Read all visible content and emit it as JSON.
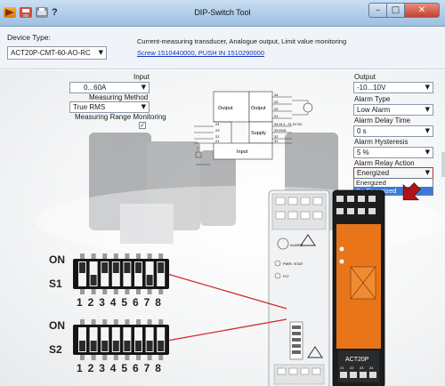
{
  "window": {
    "title": "DIP-Switch Tool",
    "help_glyph": "?",
    "icons": [
      "app-logo-icon",
      "save-icon",
      "print-icon"
    ]
  },
  "header": {
    "device_type_label": "Device Type:",
    "device_type_value": "ACT20P-CMT-60-AO-RC",
    "description": "Current-measuring transducer, Analogue output, Limit value monitoring",
    "link": "Screw 1510440000, PUSH IN 1510290000"
  },
  "input": {
    "title": "Input",
    "range_value": "0...60A",
    "method_label": "Measuring Method",
    "method_value": "True RMS",
    "monitoring_label": "Measuring Range Monitoring",
    "monitoring_checked": "✓"
  },
  "output": {
    "title": "Output",
    "output_value": "-10...10V",
    "alarm_type_label": "Alarm Type",
    "alarm_type_value": "Low Alarm",
    "alarm_delay_label": "Alarm Delay Time",
    "alarm_delay_value": "0 s",
    "alarm_hysteresis_label": "Alarm Hysteresis",
    "alarm_hysteresis_value": "5 %",
    "relay_action_label": "Alarm Relay Action",
    "relay_action_value": "Energized",
    "relay_action_options": [
      "Energized",
      "De Energized"
    ]
  },
  "diagram": {
    "output_label_1": "Output",
    "output_label_2": "Output",
    "supply_label": "Supply",
    "input_label": "Input",
    "pins_top": [
      "44",
      "43",
      "42",
      "41"
    ],
    "pins_mid": [
      "34",
      "33",
      "32",
      "31"
    ],
    "pins_left": [
      "24",
      "23",
      "22",
      "21"
    ],
    "supply_text_1": "19.2...31.2V DC",
    "supply_text_2": "GND"
  },
  "dip": {
    "s1_on_label": "ON",
    "s1_name": "S1",
    "s2_on_label": "ON",
    "s2_name": "S2",
    "numbers": [
      "1",
      "2",
      "3",
      "4",
      "5",
      "6",
      "7",
      "8"
    ],
    "s1_states": [
      "up",
      "down",
      "up",
      "up",
      "up",
      "up",
      "down",
      "up"
    ],
    "s2_states": [
      "down",
      "down",
      "down",
      "down",
      "down",
      "down",
      "down",
      "down"
    ]
  },
  "device": {
    "front_label_1": "ALARM",
    "front_label_2": "PWR / STAT",
    "front_label_3": "FLT",
    "orange_model": "ACT20P",
    "orange_terminals": [
      "21",
      "22",
      "23",
      "24"
    ]
  },
  "colors": {
    "accent_orange": "#e8751a",
    "link_blue": "#1438c8",
    "highlight_blue": "#3b7ad8",
    "line_red": "#d32a2a",
    "cursor_red": "#b0141a"
  }
}
